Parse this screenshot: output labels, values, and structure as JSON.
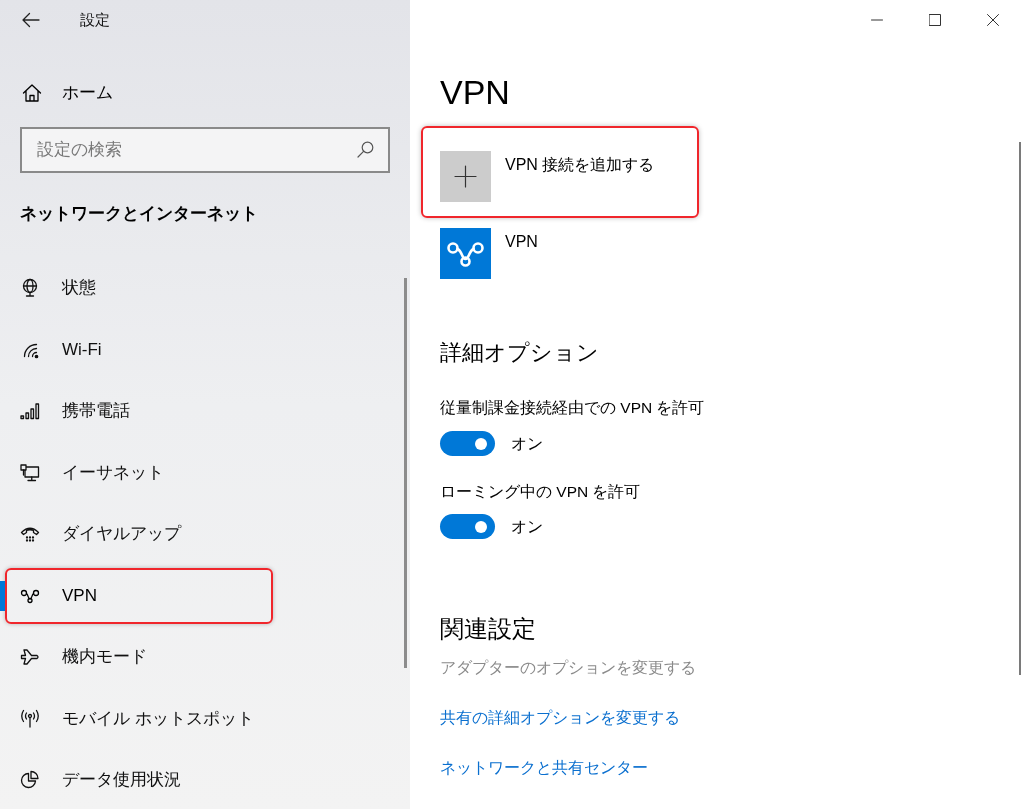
{
  "window": {
    "title": "設定"
  },
  "sidebar": {
    "home": {
      "label": "ホーム"
    },
    "search": {
      "placeholder": "設定の検索"
    },
    "section_title": "ネットワークとインターネット",
    "items": [
      {
        "label": "状態",
        "selected": false,
        "highlighted": false
      },
      {
        "label": "Wi-Fi",
        "selected": false,
        "highlighted": false
      },
      {
        "label": "携帯電話",
        "selected": false,
        "highlighted": false
      },
      {
        "label": "イーサネット",
        "selected": false,
        "highlighted": false
      },
      {
        "label": "ダイヤルアップ",
        "selected": false,
        "highlighted": false
      },
      {
        "label": "VPN",
        "selected": true,
        "highlighted": true
      },
      {
        "label": "機内モード",
        "selected": false,
        "highlighted": false
      },
      {
        "label": "モバイル ホットスポット",
        "selected": false,
        "highlighted": false
      },
      {
        "label": "データ使用状況",
        "selected": false,
        "highlighted": false
      }
    ]
  },
  "content": {
    "title": "VPN",
    "add_connection": {
      "label": "VPN 接続を追加する",
      "highlighted": true
    },
    "connections": [
      {
        "name": "VPN"
      }
    ],
    "advanced_options": {
      "title": "詳細オプション",
      "settings": [
        {
          "label": "従量制課金接続経由での VPN を許可",
          "on": true,
          "state_text": "オン"
        },
        {
          "label": "ローミング中の VPN を許可",
          "on": true,
          "state_text": "オン"
        }
      ]
    },
    "related_settings": {
      "title": "関連設定",
      "links": [
        {
          "label": "アダプターのオプションを変更する",
          "disabled": true
        },
        {
          "label": "共有の詳細オプションを変更する",
          "disabled": false
        },
        {
          "label": "ネットワークと共有センター",
          "disabled": false
        }
      ]
    }
  }
}
